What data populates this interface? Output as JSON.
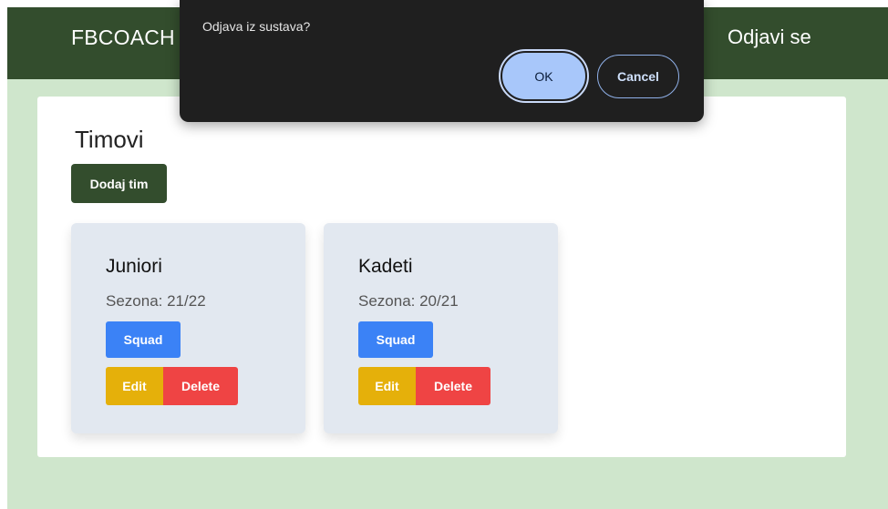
{
  "navbar": {
    "brand": "FBCOACH",
    "logout": "Odjavi se"
  },
  "main": {
    "title": "Timovi",
    "add_button": "Dodaj tim",
    "teams": [
      {
        "name": "Juniori",
        "season": "Sezona: 21/22",
        "squad_label": "Squad",
        "edit_label": "Edit",
        "delete_label": "Delete"
      },
      {
        "name": "Kadeti",
        "season": "Sezona: 20/21",
        "squad_label": "Squad",
        "edit_label": "Edit",
        "delete_label": "Delete"
      }
    ]
  },
  "dialog": {
    "message": "Odjava iz sustava?",
    "ok_label": "OK",
    "cancel_label": "Cancel"
  },
  "colors": {
    "navbar": "#334d2d",
    "background": "#cfe6cc",
    "squad": "#3b82f6",
    "edit": "#e5b00a",
    "delete": "#ef4444",
    "card": "#e2e8f0"
  }
}
